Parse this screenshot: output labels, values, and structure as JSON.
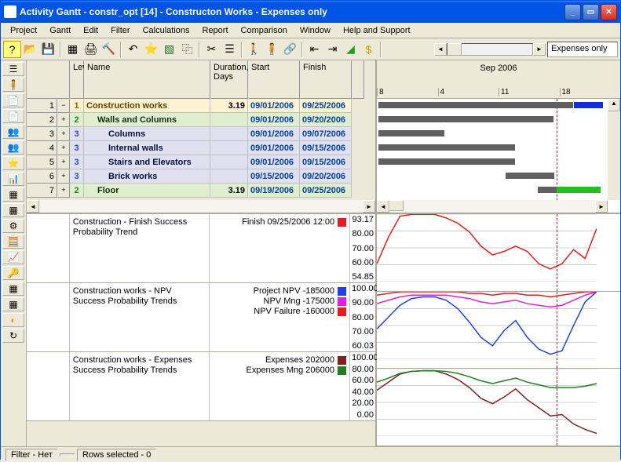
{
  "title": "Activity Gantt - constr_opt [14] - Constructon Works - Expenses only",
  "menu": [
    "Project",
    "Gantt",
    "Edit",
    "Filter",
    "Calculations",
    "Report",
    "Comparison",
    "Window",
    "Help and Support"
  ],
  "toolbar_right_field": "Expenses only",
  "columns": {
    "num": "",
    "lev": "Lev",
    "name": "Name",
    "dur": "Duration, Days",
    "start": "Start",
    "fin": "Finish"
  },
  "timeline": {
    "month": "Sep 2006",
    "ticks": [
      "8",
      "4",
      "11",
      "18"
    ]
  },
  "rows": [
    {
      "n": "1",
      "exp": "−",
      "lev": "1",
      "name": "Construction works",
      "dur": "3.19",
      "start": "09/01/2006",
      "fin": "09/25/2006"
    },
    {
      "n": "2",
      "exp": "+",
      "lev": "2",
      "name": "Walls and Columns",
      "dur": "",
      "start": "09/01/2006",
      "fin": "09/20/2006"
    },
    {
      "n": "3",
      "exp": "+",
      "lev": "3",
      "name": "Columns",
      "dur": "",
      "start": "09/01/2006",
      "fin": "09/07/2006"
    },
    {
      "n": "4",
      "exp": "+",
      "lev": "3",
      "name": "Internal walls",
      "dur": "",
      "start": "09/01/2006",
      "fin": "09/15/2006"
    },
    {
      "n": "5",
      "exp": "+",
      "lev": "3",
      "name": "Stairs and Elevators",
      "dur": "",
      "start": "09/01/2006",
      "fin": "09/15/2006"
    },
    {
      "n": "6",
      "exp": "+",
      "lev": "3",
      "name": "Brick works",
      "dur": "",
      "start": "09/15/2006",
      "fin": "09/20/2006"
    },
    {
      "n": "7",
      "exp": "+",
      "lev": "2",
      "name": "Floor",
      "dur": "3.19",
      "start": "09/19/2006",
      "fin": "09/25/2006"
    }
  ],
  "trend1": {
    "title": "Construction - Finish Success Probability Trend",
    "legend": "Finish 09/25/2006  12:00",
    "yticks": [
      "93.17",
      "80.00",
      "70.00",
      "60.00",
      "54.85"
    ]
  },
  "trend2": {
    "title": "Construction works - NPV Success Probability Trends",
    "legends": [
      {
        "t": "Project NPV -185000",
        "c": "sq-blue"
      },
      {
        "t": "NPV Mng -175000",
        "c": "sq-mag"
      },
      {
        "t": "NPV Failure -160000",
        "c": "sq-red"
      }
    ],
    "yticks": [
      "100.00",
      "90.00",
      "80.00",
      "70.00",
      "60.03"
    ]
  },
  "trend3": {
    "title": "Construction works - Expenses Success Probability Trends",
    "legends": [
      {
        "t": "Expenses 202000",
        "c": "sq-dred"
      },
      {
        "t": "Expenses Mng 206000",
        "c": "sq-grn"
      }
    ],
    "yticks": [
      "100.00",
      "80.00",
      "60.00",
      "40.00",
      "20.00",
      "0.00"
    ]
  },
  "status": {
    "filter": "Filter -  Нет",
    "rows": "Rows selected -  0"
  },
  "chart_data": [
    {
      "type": "line",
      "title": "Finish Success Probability",
      "x": [
        1,
        2,
        3,
        4,
        5,
        6,
        7,
        8,
        9,
        10,
        11,
        12,
        13,
        14,
        15,
        16,
        17,
        18,
        19,
        20
      ],
      "series": [
        {
          "name": "Finish 09/25/2006 12:00",
          "color": "#e02020",
          "values": [
            65,
            80,
            92,
            93,
            93,
            93,
            91,
            88,
            83,
            75,
            70,
            72,
            75,
            72,
            65,
            62,
            65,
            73,
            68,
            85
          ]
        }
      ],
      "ylim": [
        54.85,
        93.17
      ]
    },
    {
      "type": "line",
      "title": "NPV Success Probability",
      "x": [
        1,
        2,
        3,
        4,
        5,
        6,
        7,
        8,
        9,
        10,
        11,
        12,
        13,
        14,
        15,
        16,
        17,
        18,
        19,
        20
      ],
      "series": [
        {
          "name": "Project NPV -185000",
          "color": "#2040e0",
          "values": [
            78,
            85,
            92,
            96,
            97,
            97,
            95,
            90,
            82,
            73,
            68,
            77,
            83,
            73,
            66,
            63,
            65,
            80,
            94,
            100
          ]
        },
        {
          "name": "NPV Mng -175000",
          "color": "#e020e0",
          "values": [
            93,
            95,
            97,
            98,
            98,
            98,
            98,
            97,
            96,
            94,
            93,
            94,
            95,
            93,
            92,
            91,
            92,
            95,
            98,
            100
          ]
        },
        {
          "name": "NPV Failure -160000",
          "color": "#e02020",
          "values": [
            98,
            99,
            100,
            100,
            100,
            100,
            100,
            100,
            99,
            99,
            98,
            99,
            99,
            98,
            98,
            97,
            98,
            99,
            100,
            100
          ]
        }
      ],
      "ylim": [
        60.03,
        100
      ]
    },
    {
      "type": "line",
      "title": "Expenses Success Probability",
      "x": [
        1,
        2,
        3,
        4,
        5,
        6,
        7,
        8,
        9,
        10,
        11,
        12,
        13,
        14,
        15,
        16,
        17,
        18,
        19,
        20
      ],
      "series": [
        {
          "name": "Expenses 202000",
          "color": "#802020",
          "values": [
            68,
            80,
            92,
            96,
            97,
            97,
            92,
            84,
            72,
            56,
            48,
            58,
            70,
            54,
            42,
            30,
            32,
            18,
            10,
            4
          ]
        },
        {
          "name": "Expenses Mng 206000",
          "color": "#208020",
          "values": [
            80,
            86,
            93,
            96,
            97,
            97,
            96,
            93,
            88,
            82,
            78,
            82,
            86,
            80,
            76,
            72,
            72,
            72,
            74,
            78
          ]
        }
      ],
      "ylim": [
        0,
        100
      ]
    }
  ]
}
